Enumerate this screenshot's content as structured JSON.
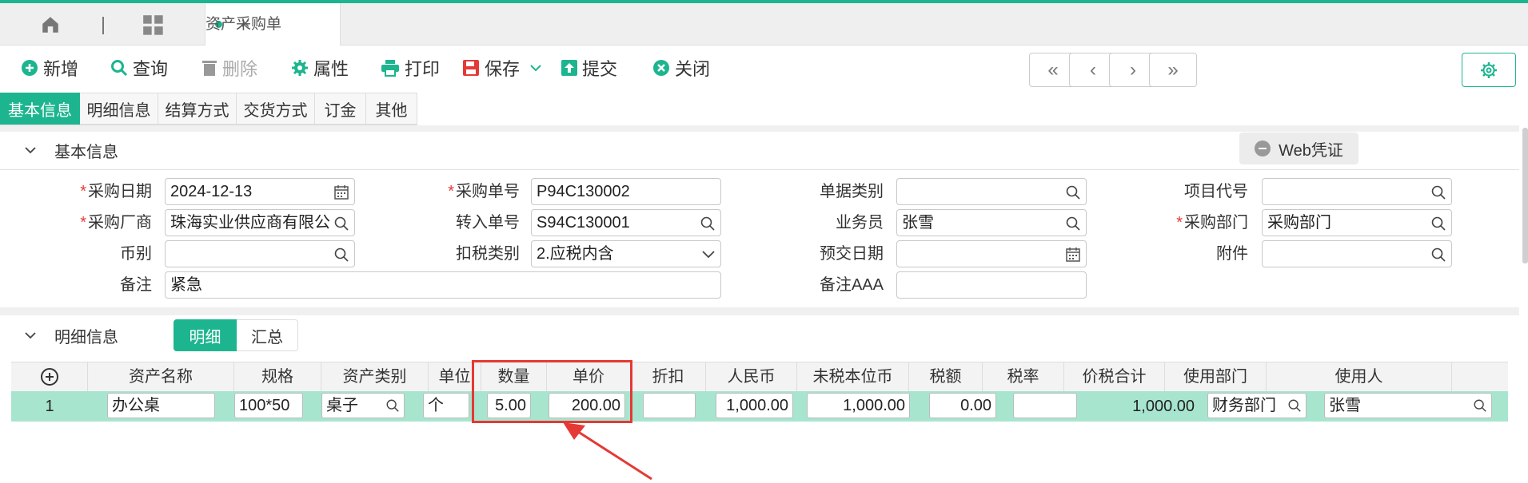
{
  "tabbar": {
    "doc_tab": "资产采购单",
    "close": "×"
  },
  "toolbar": {
    "add": "新增",
    "query": "查询",
    "delete": "删除",
    "props": "属性",
    "print": "打印",
    "save": "保存",
    "submit": "提交",
    "close": "关闭"
  },
  "nav": {
    "first": "«",
    "prev": "‹",
    "next": "›",
    "last": "»"
  },
  "subtabs": [
    "基本信息",
    "明细信息",
    "结算方式",
    "交货方式",
    "订金",
    "其他"
  ],
  "basic": {
    "title": "基本信息",
    "web_btn": "Web凭证",
    "fields": {
      "purchase_date": {
        "label": "采购日期",
        "value": "2024-12-13"
      },
      "purchase_no": {
        "label": "采购单号",
        "value": "P94C130002"
      },
      "doc_type": {
        "label": "单据类别",
        "value": ""
      },
      "project_code": {
        "label": "项目代号",
        "value": ""
      },
      "vendor": {
        "label": "采购厂商",
        "value": "珠海实业供应商有限公"
      },
      "transfer_no": {
        "label": "转入单号",
        "value": "S94C130001"
      },
      "salesman": {
        "label": "业务员",
        "value": "张雪"
      },
      "dept": {
        "label": "采购部门",
        "value": "采购部门"
      },
      "currency": {
        "label": "币别",
        "value": ""
      },
      "tax_type": {
        "label": "扣税类别",
        "value": "2.应税内含"
      },
      "delivery_date": {
        "label": "预交日期",
        "value": ""
      },
      "attachment": {
        "label": "附件",
        "value": ""
      },
      "remark": {
        "label": "备注",
        "value": "紧急"
      },
      "remark_aaa": {
        "label": "备注AAA",
        "value": ""
      }
    }
  },
  "detail": {
    "title": "明细信息",
    "toggle_detail": "明细",
    "toggle_summary": "汇总",
    "columns": [
      "资产名称",
      "规格",
      "资产类别",
      "单位",
      "数量",
      "单价",
      "折扣",
      "人民币",
      "未税本位币",
      "税额",
      "税率",
      "价税合计",
      "使用部门",
      "使用人"
    ],
    "row": {
      "index": "1",
      "name": "办公桌",
      "spec": "100*50",
      "category": "桌子",
      "unit": "个",
      "qty": "5.00",
      "price": "200.00",
      "discount": "",
      "rmb": "1,000.00",
      "untaxed": "1,000.00",
      "tax": "0.00",
      "tax_rate": "",
      "total": "1,000.00",
      "use_dept": "财务部门",
      "user": "张雪"
    }
  },
  "colors": {
    "accent": "#1db58f",
    "highlight": "#e53935",
    "row_selected": "#a8e5cf"
  }
}
